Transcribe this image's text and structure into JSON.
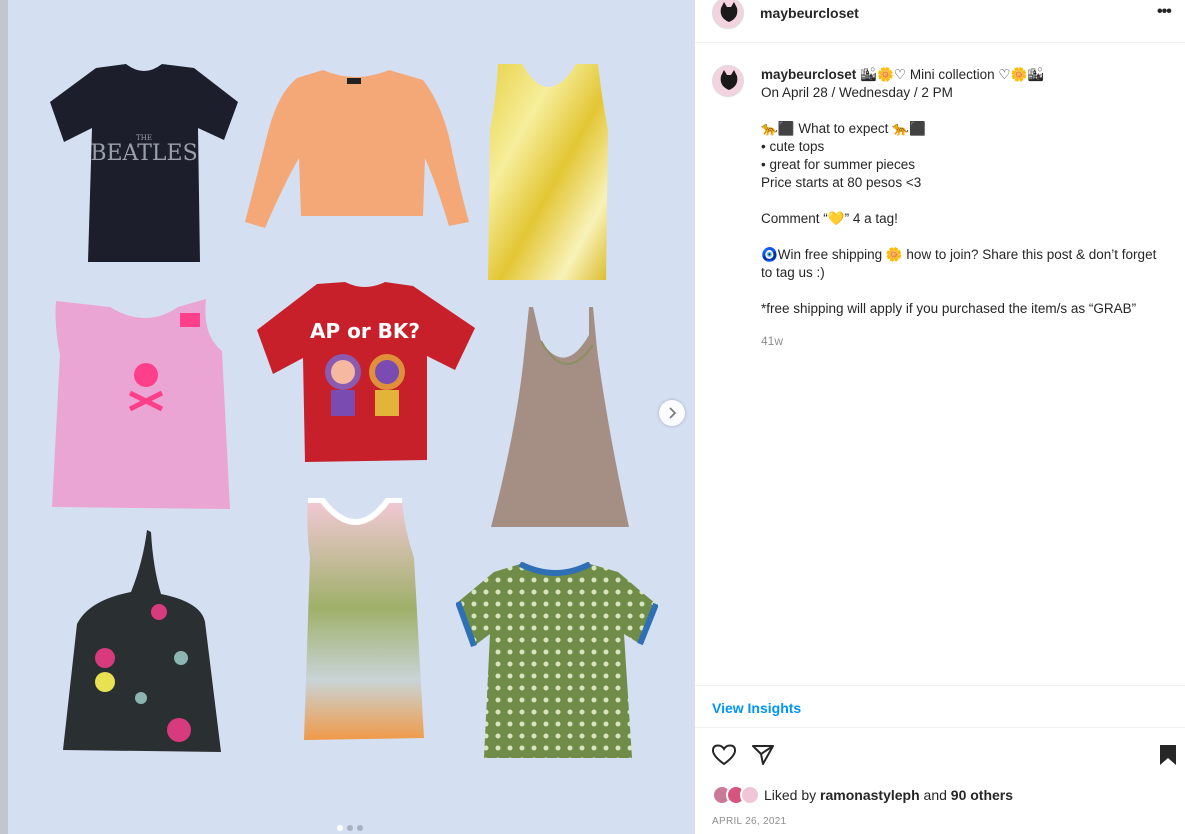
{
  "post": {
    "username": "maybeurcloset",
    "more_label": "•••",
    "caption_title": " 🏙🌼♡ Mini collection ♡🌼🏙",
    "caption_lines": [
      "On April 28 / Wednesday / 2 PM",
      "",
      "🐆⬛ What to expect 🐆⬛",
      "• cute tops",
      "• great for summer pieces",
      "Price starts at 80 pesos <3",
      "",
      "Comment “💛” 4 a tag!",
      "",
      "🧿Win free shipping 🌼 how to join? Share this post & don’t forget to tag us :)",
      "",
      "*free shipping will apply if you purchased the item/s as “GRAB”"
    ],
    "relative_time": "41w",
    "view_insights": "View Insights",
    "liked_prefix": "Liked by ",
    "liked_user": "ramonastyleph",
    "liked_and": " and ",
    "liked_others": "90 others",
    "date": "APRIL 26, 2021"
  },
  "media": {
    "carousel_dots": 3,
    "active_dot": 1,
    "print_beatles": "THE BEATLES",
    "print_apbk": "AP or BK?"
  },
  "icons": {
    "more": "more-options-icon",
    "next": "chevron-right-icon",
    "like": "heart-outline-icon",
    "share": "paper-plane-icon",
    "save": "bookmark-filled-icon"
  },
  "colors": {
    "background_media": "#d5dff2",
    "link": "#0095f6",
    "text": "#262626",
    "muted": "#8e8e8e"
  }
}
